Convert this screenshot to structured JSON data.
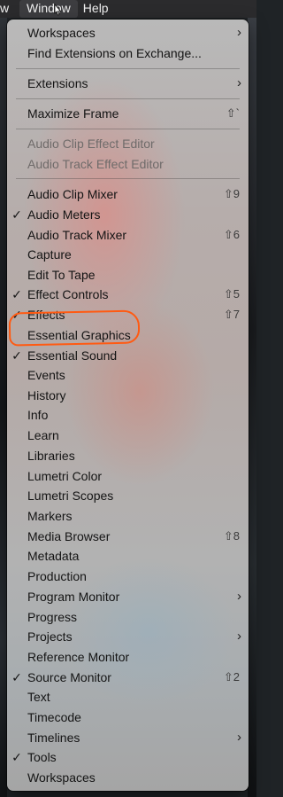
{
  "menubar": {
    "items": [
      "w",
      "Window",
      "Help"
    ]
  },
  "menu": {
    "items": [
      {
        "label": "Workspaces",
        "check": "",
        "shortcut": "",
        "submenu": true,
        "disabled": false
      },
      {
        "label": "Find Extensions on Exchange...",
        "check": "",
        "shortcut": "",
        "submenu": false,
        "disabled": false
      },
      {
        "label": "Extensions",
        "check": "",
        "shortcut": "",
        "submenu": true,
        "disabled": false
      },
      {
        "label": "Maximize Frame",
        "check": "",
        "shortcut": "⇧`",
        "submenu": false,
        "disabled": false
      },
      {
        "label": "Audio Clip Effect Editor",
        "check": "",
        "shortcut": "",
        "submenu": false,
        "disabled": true
      },
      {
        "label": "Audio Track Effect Editor",
        "check": "",
        "shortcut": "",
        "submenu": false,
        "disabled": true
      },
      {
        "label": "Audio Clip Mixer",
        "check": "",
        "shortcut": "⇧9",
        "submenu": false,
        "disabled": false
      },
      {
        "label": "Audio Meters",
        "check": "✓",
        "shortcut": "",
        "submenu": false,
        "disabled": false
      },
      {
        "label": "Audio Track Mixer",
        "check": "",
        "shortcut": "⇧6",
        "submenu": false,
        "disabled": false
      },
      {
        "label": "Capture",
        "check": "",
        "shortcut": "",
        "submenu": false,
        "disabled": false
      },
      {
        "label": "Edit To Tape",
        "check": "",
        "shortcut": "",
        "submenu": false,
        "disabled": false
      },
      {
        "label": "Effect Controls",
        "check": "✓",
        "shortcut": "⇧5",
        "submenu": false,
        "disabled": false
      },
      {
        "label": "Effects",
        "check": "✓",
        "shortcut": "⇧7",
        "submenu": false,
        "disabled": false
      },
      {
        "label": "Essential Graphics",
        "check": "",
        "shortcut": "",
        "submenu": false,
        "disabled": false
      },
      {
        "label": "Essential Sound",
        "check": "✓",
        "shortcut": "",
        "submenu": false,
        "disabled": false
      },
      {
        "label": "Events",
        "check": "",
        "shortcut": "",
        "submenu": false,
        "disabled": false
      },
      {
        "label": "History",
        "check": "",
        "shortcut": "",
        "submenu": false,
        "disabled": false
      },
      {
        "label": "Info",
        "check": "",
        "shortcut": "",
        "submenu": false,
        "disabled": false
      },
      {
        "label": "Learn",
        "check": "",
        "shortcut": "",
        "submenu": false,
        "disabled": false
      },
      {
        "label": "Libraries",
        "check": "",
        "shortcut": "",
        "submenu": false,
        "disabled": false
      },
      {
        "label": "Lumetri Color",
        "check": "",
        "shortcut": "",
        "submenu": false,
        "disabled": false
      },
      {
        "label": "Lumetri Scopes",
        "check": "",
        "shortcut": "",
        "submenu": false,
        "disabled": false
      },
      {
        "label": "Markers",
        "check": "",
        "shortcut": "",
        "submenu": false,
        "disabled": false
      },
      {
        "label": "Media Browser",
        "check": "",
        "shortcut": "⇧8",
        "submenu": false,
        "disabled": false
      },
      {
        "label": "Metadata",
        "check": "",
        "shortcut": "",
        "submenu": false,
        "disabled": false
      },
      {
        "label": "Production",
        "check": "",
        "shortcut": "",
        "submenu": false,
        "disabled": false
      },
      {
        "label": "Program Monitor",
        "check": "",
        "shortcut": "",
        "submenu": true,
        "disabled": false
      },
      {
        "label": "Progress",
        "check": "",
        "shortcut": "",
        "submenu": false,
        "disabled": false
      },
      {
        "label": "Projects",
        "check": "",
        "shortcut": "",
        "submenu": true,
        "disabled": false
      },
      {
        "label": "Reference Monitor",
        "check": "",
        "shortcut": "",
        "submenu": false,
        "disabled": false
      },
      {
        "label": "Source Monitor",
        "check": "✓",
        "shortcut": "⇧2",
        "submenu": false,
        "disabled": false
      },
      {
        "label": "Text",
        "check": "",
        "shortcut": "",
        "submenu": false,
        "disabled": false
      },
      {
        "label": "Timecode",
        "check": "",
        "shortcut": "",
        "submenu": false,
        "disabled": false
      },
      {
        "label": "Timelines",
        "check": "",
        "shortcut": "",
        "submenu": true,
        "disabled": false
      },
      {
        "label": "Tools",
        "check": "✓",
        "shortcut": "",
        "submenu": false,
        "disabled": false
      },
      {
        "label": "Workspaces",
        "check": "",
        "shortcut": "",
        "submenu": false,
        "disabled": false
      }
    ],
    "submenu_arrow": "›",
    "annotation_color": "#ff5a12"
  }
}
